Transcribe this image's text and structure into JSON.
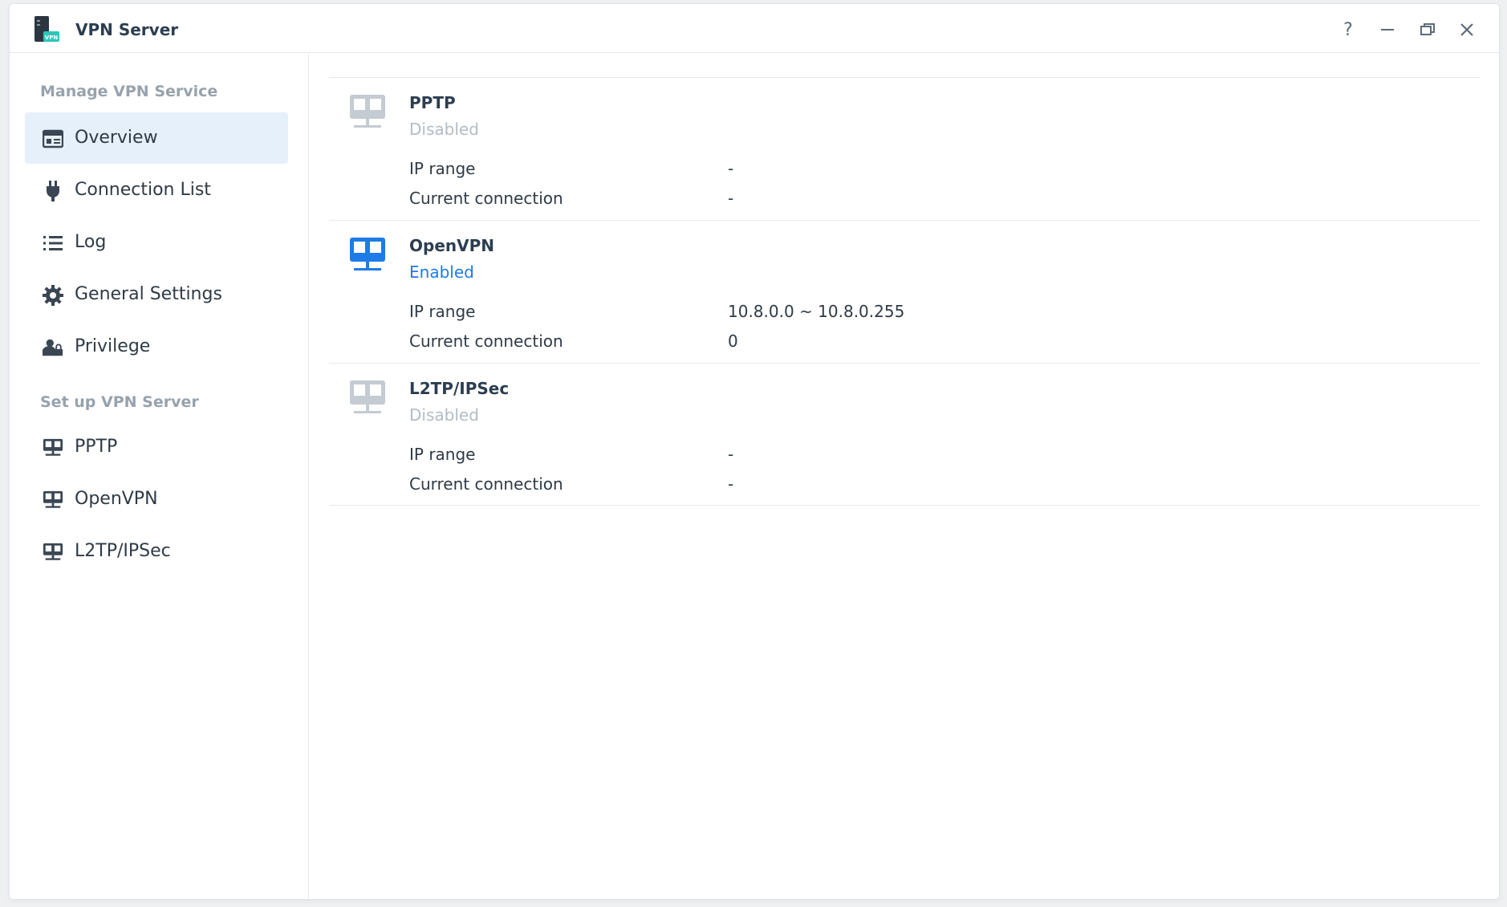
{
  "window": {
    "title": "VPN Server",
    "controls": {
      "help": "?"
    }
  },
  "sidebar": {
    "sections": [
      {
        "header": "Manage VPN Service",
        "items": [
          {
            "label": "Overview",
            "icon": "overview-card-icon",
            "active": true
          },
          {
            "label": "Connection List",
            "icon": "plug-icon"
          },
          {
            "label": "Log",
            "icon": "list-icon"
          },
          {
            "label": "General Settings",
            "icon": "gear-icon"
          },
          {
            "label": "Privilege",
            "icon": "user-lock-icon"
          }
        ]
      },
      {
        "header": "Set up VPN Server",
        "items": [
          {
            "label": "PPTP",
            "icon": "network-icon"
          },
          {
            "label": "OpenVPN",
            "icon": "network-icon"
          },
          {
            "label": "L2TP/IPSec",
            "icon": "network-icon"
          }
        ]
      }
    ]
  },
  "services": [
    {
      "name": "PPTP",
      "status": "Disabled",
      "rows": [
        {
          "label": "IP range",
          "value": "-"
        },
        {
          "label": "Current connection",
          "value": "-"
        }
      ]
    },
    {
      "name": "OpenVPN",
      "status": "Enabled",
      "rows": [
        {
          "label": "IP range",
          "value": "10.8.0.0 ~ 10.8.0.255"
        },
        {
          "label": "Current connection",
          "value": "0"
        }
      ]
    },
    {
      "name": "L2TP/IPSec",
      "status": "Disabled",
      "rows": [
        {
          "label": "IP range",
          "value": "-"
        },
        {
          "label": "Current connection",
          "value": "-"
        }
      ]
    }
  ],
  "colors": {
    "accent": "#1e7be8",
    "active_bg": "#e6f0fb",
    "disabled_text": "#b3bcc5",
    "disabled_icon": "#c4cbd2",
    "section_header": "#97a2ad"
  }
}
